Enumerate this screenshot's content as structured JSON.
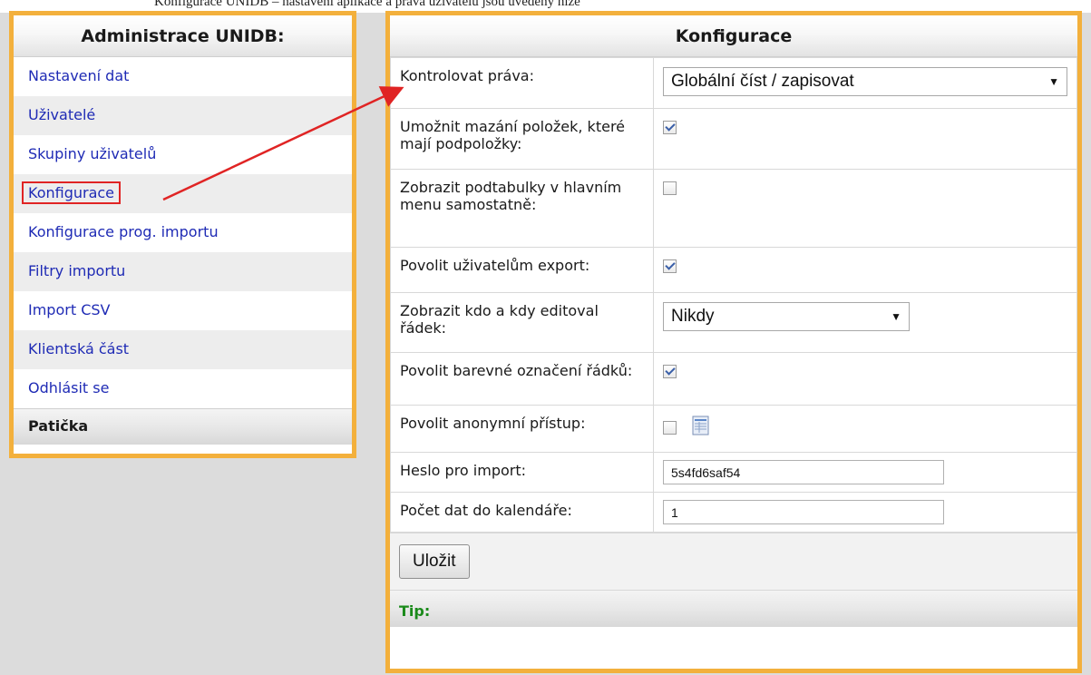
{
  "top_text": "Konfigurace UNIDB – nastavení aplikace a práva uživatelů jsou uvedeny níže",
  "sidebar": {
    "title": "Administrace UNIDB:",
    "items": [
      {
        "label": "Nastavení dat"
      },
      {
        "label": "Uživatelé"
      },
      {
        "label": "Skupiny uživatelů"
      },
      {
        "label": "Konfigurace"
      },
      {
        "label": "Konfigurace prog. importu"
      },
      {
        "label": "Filtry importu"
      },
      {
        "label": "Import CSV"
      },
      {
        "label": "Klientská část"
      },
      {
        "label": "Odhlásit se"
      }
    ],
    "footer": "Patička"
  },
  "config": {
    "title": "Konfigurace",
    "rows": {
      "rights": {
        "label": "Kontrolovat práva:",
        "value": "Globální číst / zapisovat"
      },
      "delete": {
        "label": "Umožnit mazání položek, které mají podpoložky:",
        "checked": true
      },
      "subtables": {
        "label": "Zobrazit podtabulky v hlavním menu samostatně:",
        "checked": false
      },
      "export": {
        "label": "Povolit uživatelům export:",
        "checked": true
      },
      "editor": {
        "label": "Zobrazit kdo a kdy editoval řádek:",
        "value": "Nikdy"
      },
      "color": {
        "label": "Povolit barevné označení řádků:",
        "checked": true
      },
      "anon": {
        "label": "Povolit anonymní přístup:",
        "checked": false
      },
      "password": {
        "label": "Heslo pro import:",
        "value": "5s4fd6saf54"
      },
      "calendar": {
        "label": "Počet dat do kalendáře:",
        "value": "1"
      }
    },
    "save_label": "Uložit",
    "tip_label": "Tip:"
  },
  "colors": {
    "frame": "#f3b03c",
    "link": "#1f2bb5",
    "annotation": "#e02424",
    "tip": "#1a8a1a"
  }
}
